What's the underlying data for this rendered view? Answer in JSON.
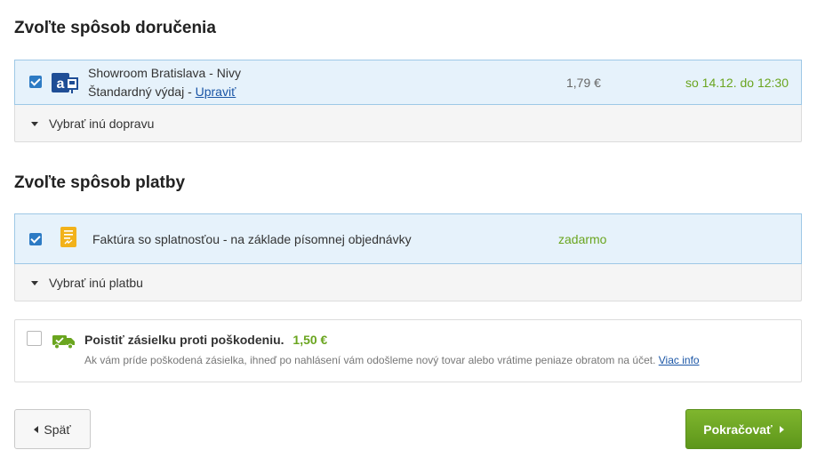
{
  "delivery": {
    "title": "Zvoľte spôsob doručenia",
    "selected": {
      "name": "Showroom Bratislava - Nivy",
      "method": "Štandardný výdaj -",
      "edit_label": "Upraviť",
      "price": "1,79 €",
      "eta": "so 14.12. do 12:30",
      "icon": "alza-showroom-icon"
    },
    "other_label": "Vybrať inú dopravu"
  },
  "payment": {
    "title": "Zvoľte spôsob platby",
    "selected": {
      "name": "Faktúra so splatnosťou - na základe písomnej objednávky",
      "price": "zadarmo",
      "icon": "invoice-icon"
    },
    "other_label": "Vybrať inú platbu"
  },
  "insurance": {
    "title": "Poistiť zásielku proti poškodeniu.",
    "price": "1,50 €",
    "description": "Ak vám príde poškodená zásielka, ihneď po nahlásení vám odošleme nový tovar alebo vrátime peniaze obratom na účet.",
    "more_label": "Viac info",
    "checked": false,
    "icon": "delivery-truck-check-icon"
  },
  "nav": {
    "back_label": "Späť",
    "next_label": "Pokračovať"
  },
  "colors": {
    "accent_green": "#6aa51f",
    "link_blue": "#1b56a6",
    "checkbox_blue": "#2d7bc4",
    "selected_bg": "#e6f2fb"
  }
}
